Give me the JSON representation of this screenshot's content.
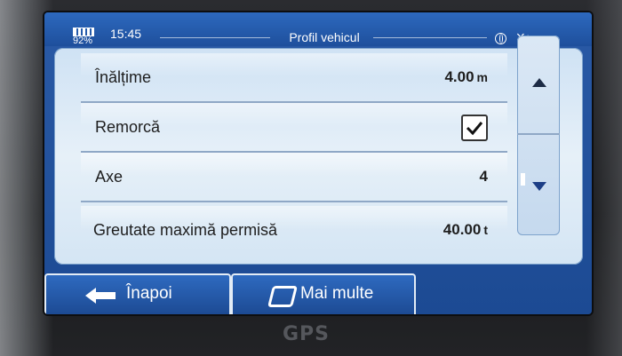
{
  "status_bar": {
    "battery_percent": "92%",
    "time": "15:45",
    "title": "Profil vehicul",
    "icons": [
      "globe-icon",
      "gps-satellite-icon"
    ]
  },
  "settings": [
    {
      "label": "Înălțime",
      "value": "4.00",
      "unit": "m"
    },
    {
      "label": "Remorcă",
      "checked": true
    },
    {
      "label": "Axe",
      "value": "4"
    },
    {
      "label": "Greutate maximă permisă",
      "value": "40.00",
      "unit": "t"
    }
  ],
  "buttons": {
    "back": "Înapoi",
    "more": "Mai multe"
  },
  "device": {
    "brand": "GPS"
  },
  "colors": {
    "screen_blue": "#1c4a93",
    "panel": "#e6f0f8",
    "text": "#1e1e1e"
  }
}
